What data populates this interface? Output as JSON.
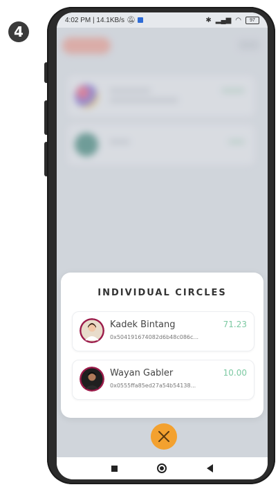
{
  "step_number": "4",
  "status_bar": {
    "left_text": "4:02 PM | 14.1KB/s",
    "battery": "97"
  },
  "modal": {
    "title": "INDIVIDUAL CIRCLES",
    "items": [
      {
        "name": "Kadek Bintang",
        "address": "0x504191674082d6b48c086c...",
        "value": "71.23"
      },
      {
        "name": "Wayan Gabler",
        "address": "0x0555ffa85ed27a54b54138...",
        "value": "10.00"
      }
    ]
  },
  "colors": {
    "accent_orange": "#f3a12f",
    "value_green": "#7cc9a2"
  },
  "icons": {
    "close": "close-icon",
    "nav_recent": "recent-apps-icon",
    "nav_home": "home-icon",
    "nav_back": "back-icon"
  }
}
